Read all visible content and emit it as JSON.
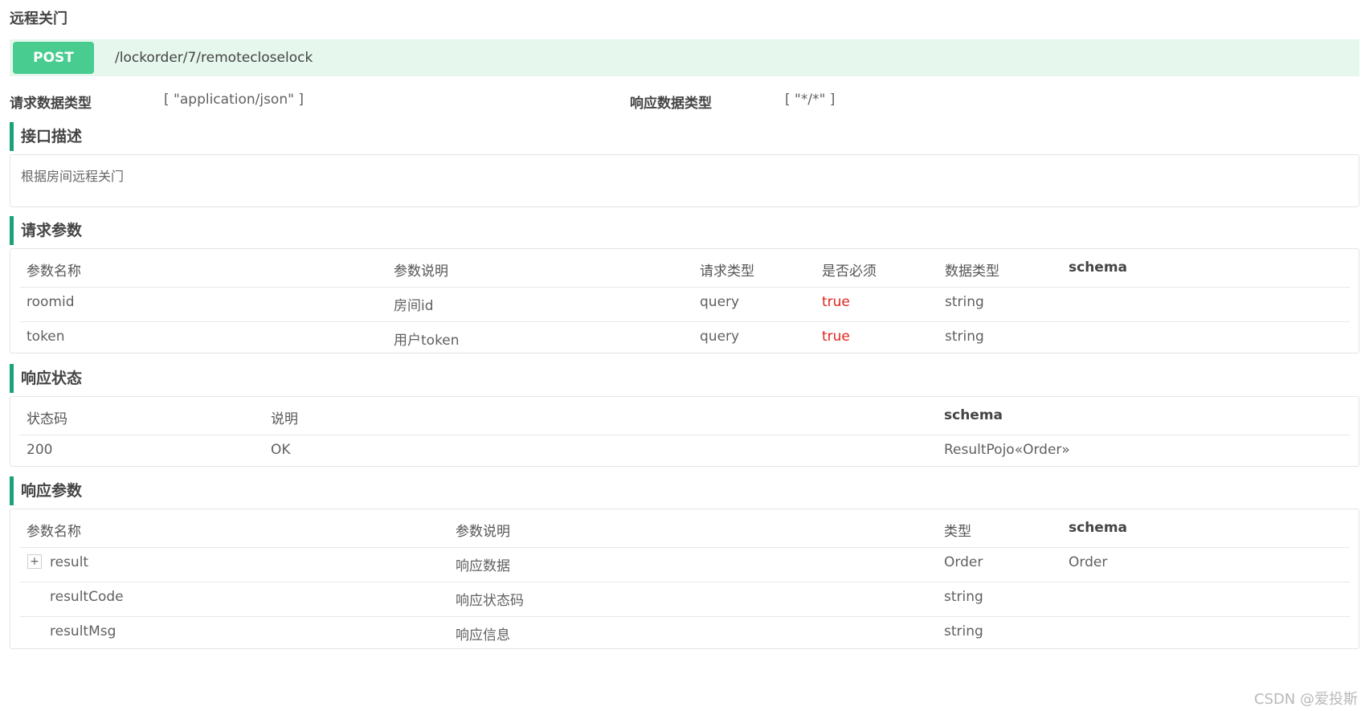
{
  "page": {
    "title": "远程关门",
    "method": "POST",
    "path": "/lockorder/7/remotecloselock",
    "request_type_label": "请求数据类型",
    "request_type_value": "[ \"application/json\" ]",
    "response_type_label": "响应数据类型",
    "response_type_value": "[ \"*/*\" ]"
  },
  "description": {
    "heading": "接口描述",
    "text": "根据房间远程关门"
  },
  "request_params": {
    "heading": "请求参数",
    "headers": [
      "参数名称",
      "参数说明",
      "请求类型",
      "是否必须",
      "数据类型",
      "schema"
    ],
    "rows": [
      [
        "roomid",
        "房间id",
        "query",
        "true",
        "string",
        ""
      ],
      [
        "token",
        "用户token",
        "query",
        "true",
        "string",
        ""
      ]
    ]
  },
  "response_status": {
    "heading": "响应状态",
    "headers": [
      "状态码",
      "说明",
      "schema"
    ],
    "rows": [
      [
        "200",
        "OK",
        "ResultPojo«Order»"
      ]
    ]
  },
  "response_params": {
    "heading": "响应参数",
    "headers": [
      "参数名称",
      "参数说明",
      "类型",
      "schema"
    ],
    "expand_symbol": "+",
    "rows": [
      [
        "result",
        "响应数据",
        "Order",
        "Order"
      ],
      [
        "resultCode",
        "响应状态码",
        "string",
        ""
      ],
      [
        "resultMsg",
        "响应信息",
        "string",
        ""
      ]
    ]
  },
  "watermark": "CSDN @爱投斯",
  "colors": {
    "method_bg": "#49cc90",
    "method_bar_bg": "#e6f7ee",
    "section_accent": "#1aa27a",
    "required_true": "#e0231c"
  }
}
